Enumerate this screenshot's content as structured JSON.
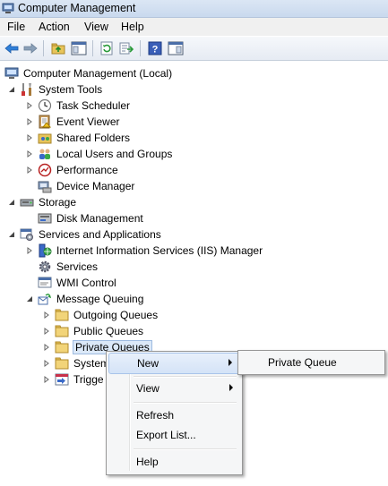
{
  "window": {
    "title": "Computer Management"
  },
  "menubar": {
    "items": [
      "File",
      "Action",
      "View",
      "Help"
    ]
  },
  "toolbar": {
    "buttons": [
      "back-arrow-icon",
      "forward-arrow-icon",
      "up-folder-icon",
      "show-hide-tree-icon",
      "refresh-icon",
      "export-list-icon",
      "help-icon",
      "show-hide-action-pane-icon"
    ]
  },
  "tree": {
    "root": "Computer Management (Local)",
    "system_tools": "System Tools",
    "task_scheduler": "Task Scheduler",
    "event_viewer": "Event Viewer",
    "shared_folders": "Shared Folders",
    "local_users_groups": "Local Users and Groups",
    "performance": "Performance",
    "device_manager": "Device Manager",
    "storage": "Storage",
    "disk_management": "Disk Management",
    "services_apps": "Services and Applications",
    "iis_manager": "Internet Information Services (IIS) Manager",
    "services": "Services",
    "wmi_control": "WMI Control",
    "message_queuing": "Message Queuing",
    "outgoing_queues": "Outgoing Queues",
    "public_queues": "Public Queues",
    "private_queues": "Private Queues",
    "system_queues": "System",
    "triggers": "Trigge"
  },
  "context_menu": {
    "new": "New",
    "view": "View",
    "refresh": "Refresh",
    "export_list": "Export List...",
    "help": "Help"
  },
  "submenu": {
    "private_queue": "Private Queue"
  }
}
